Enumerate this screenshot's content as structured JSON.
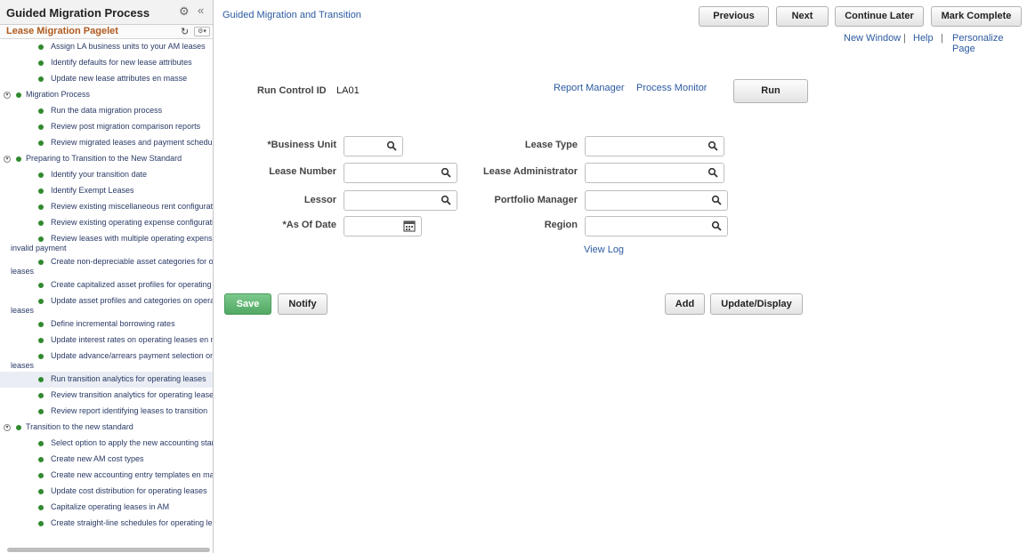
{
  "sidebar": {
    "title": "Guided Migration Process",
    "pagelet_title": "Lease Migration Pagelet",
    "items": [
      {
        "label": "Assign LA business units to your AM leases",
        "type": "leaf"
      },
      {
        "label": "Identify defaults for new lease attributes",
        "type": "leaf"
      },
      {
        "label": "Update new lease attributes en masse",
        "type": "leaf"
      },
      {
        "label": "Migration Process",
        "type": "group"
      },
      {
        "label": "Run the data migration process",
        "type": "leaf"
      },
      {
        "label": "Review post migration comparison reports",
        "type": "leaf"
      },
      {
        "label": "Review migrated leases and payment schedules",
        "type": "leaf"
      },
      {
        "label": "Preparing to Transition to the New Standard",
        "type": "group"
      },
      {
        "label": "Identify your transition date",
        "type": "leaf"
      },
      {
        "label": "Identify Exempt Leases",
        "type": "leaf"
      },
      {
        "label": "Review existing miscellaneous rent configuration",
        "type": "leaf"
      },
      {
        "label": "Review existing operating expense configuration",
        "type": "leaf"
      },
      {
        "label": "Review leases with multiple operating expense",
        "label2": "invalid payment",
        "type": "leaf2"
      },
      {
        "label": "Create non-depreciable asset categories for operating",
        "label2": "leases",
        "type": "leaf2"
      },
      {
        "label": "Create capitalized asset profiles for operating leases",
        "type": "leaf"
      },
      {
        "label": "Update asset profiles and categories on operating",
        "label2": "leases",
        "type": "leaf2"
      },
      {
        "label": "Define incremental borrowing rates",
        "type": "leaf"
      },
      {
        "label": "Update interest rates on operating leases en masse",
        "type": "leaf"
      },
      {
        "label": "Update advance/arrears payment selection on",
        "label2": "leases",
        "type": "leaf2"
      },
      {
        "label": "Run transition analytics for operating leases",
        "type": "leaf",
        "selected": true
      },
      {
        "label": "Review transition analytics for operating leases",
        "type": "leaf"
      },
      {
        "label": "Review report identifying leases to transition",
        "type": "leaf"
      },
      {
        "label": "Transition to the new standard",
        "type": "group"
      },
      {
        "label": "Select option to apply the new accounting standard",
        "type": "leaf"
      },
      {
        "label": "Create new AM cost types",
        "type": "leaf"
      },
      {
        "label": "Create new accounting entry templates en masse",
        "type": "leaf"
      },
      {
        "label": "Update cost distribution for operating leases",
        "type": "leaf"
      },
      {
        "label": "Capitalize operating leases in AM",
        "type": "leaf"
      },
      {
        "label": "Create straight-line schedules for operating leases",
        "type": "leaf"
      }
    ]
  },
  "header": {
    "breadcrumb": "Guided Migration and Transition",
    "buttons": [
      "Previous",
      "Next",
      "Continue Later",
      "Mark Complete"
    ],
    "links": [
      "New Window",
      "Help",
      "Personalize Page"
    ],
    "separator": "|"
  },
  "run_control": {
    "label": "Run Control ID",
    "value": "LA01",
    "report_manager": "Report Manager",
    "process_monitor": "Process Monitor",
    "run_button": "Run"
  },
  "form": {
    "business_unit": "*Business Unit",
    "lease_number": "Lease Number",
    "lessor": "Lessor",
    "as_of_date": "*As Of Date",
    "lease_type": "Lease Type",
    "lease_administrator": "Lease Administrator",
    "portfolio_manager": "Portfolio Manager",
    "region": "Region",
    "view_log": "View Log"
  },
  "actions": {
    "save": "Save",
    "notify": "Notify",
    "add": "Add",
    "update_display": "Update/Display"
  },
  "colors": {
    "link": "#2b5aa0",
    "pagelet_title": "#b05a1e",
    "bullet": "#2f8a2f",
    "save_button": "#5aaf6c"
  }
}
